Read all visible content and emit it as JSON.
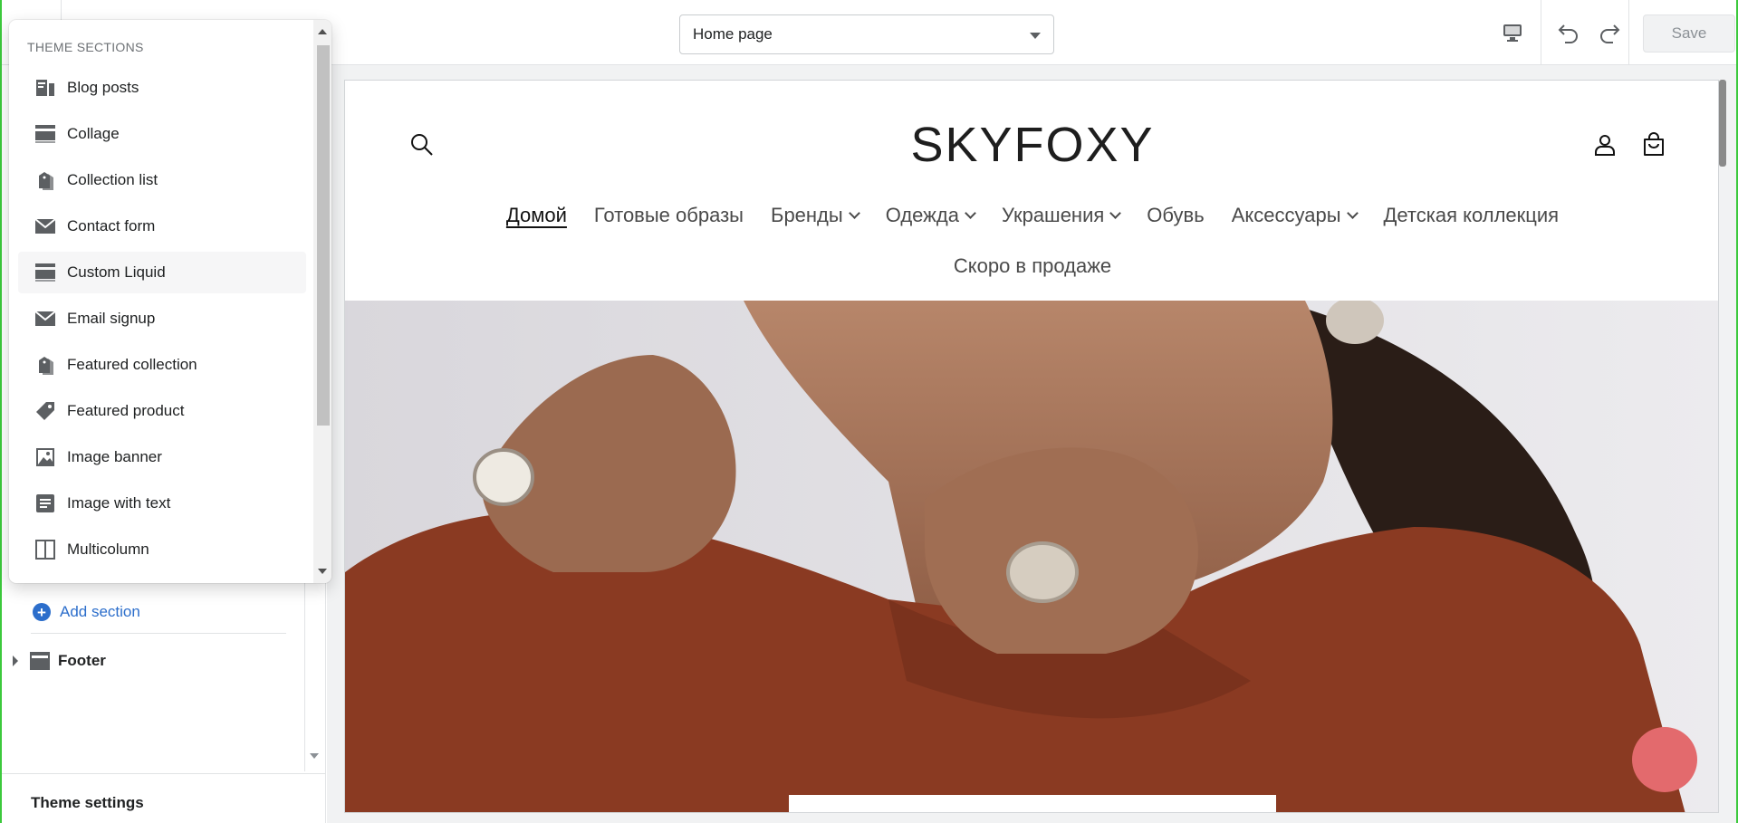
{
  "topbar": {
    "page_selector": "Home page",
    "save_label": "Save"
  },
  "popover": {
    "heading": "THEME SECTIONS",
    "items": [
      {
        "label": "Blog posts",
        "icon": "blog-icon"
      },
      {
        "label": "Collage",
        "icon": "section-icon"
      },
      {
        "label": "Collection list",
        "icon": "collection-icon"
      },
      {
        "label": "Contact form",
        "icon": "envelope-icon"
      },
      {
        "label": "Custom Liquid",
        "icon": "section-icon"
      },
      {
        "label": "Email signup",
        "icon": "envelope-icon"
      },
      {
        "label": "Featured collection",
        "icon": "collection-icon"
      },
      {
        "label": "Featured product",
        "icon": "tag-icon"
      },
      {
        "label": "Image banner",
        "icon": "image-icon"
      },
      {
        "label": "Image with text",
        "icon": "text-icon"
      },
      {
        "label": "Multicolumn",
        "icon": "columns-icon"
      }
    ],
    "highlighted_index": 4
  },
  "sidebar": {
    "add_section_label": "Add section",
    "footer_label": "Footer",
    "theme_settings_label": "Theme settings"
  },
  "store": {
    "logo": "SKYFOXY",
    "nav": [
      {
        "label": "Домой",
        "dropdown": false,
        "current": true
      },
      {
        "label": "Готовые образы",
        "dropdown": false,
        "current": false
      },
      {
        "label": "Бренды",
        "dropdown": true,
        "current": false
      },
      {
        "label": "Одежда",
        "dropdown": true,
        "current": false
      },
      {
        "label": "Украшения",
        "dropdown": true,
        "current": false
      },
      {
        "label": "Обувь",
        "dropdown": false,
        "current": false
      },
      {
        "label": "Аксессуары",
        "dropdown": true,
        "current": false
      },
      {
        "label": "Детская коллекция",
        "dropdown": false,
        "current": false
      }
    ],
    "nav_second_row": "Скоро в продаже"
  },
  "colors": {
    "accent_blue": "#2c6ecb",
    "chat_bubble": "#e36a6d",
    "sweater": "#8a3a22",
    "frame_green": "#3cc93c"
  }
}
